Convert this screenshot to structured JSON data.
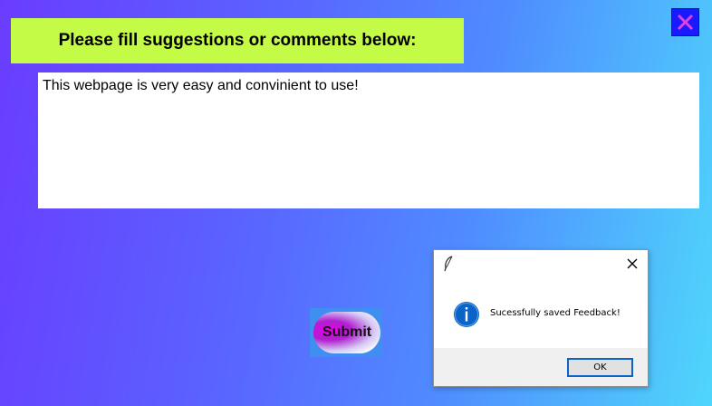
{
  "header": {
    "title": "Please fill suggestions or comments below:"
  },
  "feedback": {
    "value": "This webpage is very easy and convinient to use!"
  },
  "submit": {
    "label": "Submit"
  },
  "dialog": {
    "message": "Sucessfully saved Feedback!",
    "ok_label": "OK",
    "title_icon": "feather-icon",
    "message_icon": "info-icon"
  },
  "colors": {
    "header_bg": "#c4fb46",
    "close_bg": "#1a1aff",
    "close_x": "#e040e0",
    "info_blue": "#0a64c8"
  },
  "icons": {
    "window_close": "close-icon",
    "dialog_close": "close-icon"
  }
}
